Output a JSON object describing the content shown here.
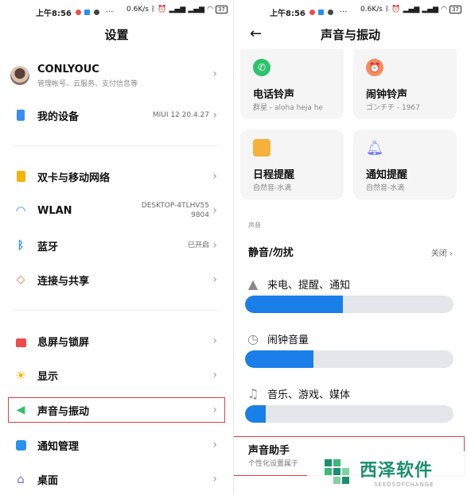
{
  "status_bar": {
    "time": "上午8:56",
    "speed": "0.6K/s",
    "battery": "37",
    "more": "···"
  },
  "left": {
    "title": "设置",
    "account": {
      "name": "CONLYOUC",
      "subtitle": "管理帐号、云服务、支付信息等"
    },
    "items": [
      {
        "label": "我的设备",
        "value": "MIUI 12 20.4.27",
        "icon": "phone-icon",
        "color": "#3a8df0"
      },
      {
        "label": "双卡与移动网络",
        "value": "",
        "icon": "sim-card-icon",
        "color": "#f5b400"
      },
      {
        "label": "WLAN",
        "value": "DESKTOP-4TLHV55\n9804",
        "icon": "wifi-icon",
        "color": "#2aa8f2"
      },
      {
        "label": "蓝牙",
        "value": "已开启",
        "icon": "bluetooth-icon",
        "color": "#2a8ff2"
      },
      {
        "label": "连接与共享",
        "value": "",
        "icon": "share-icon",
        "color": "#f06a3a"
      },
      {
        "label": "息屏与锁屏",
        "value": "",
        "icon": "lock-icon",
        "color": "#f04b4b"
      },
      {
        "label": "显示",
        "value": "",
        "icon": "sun-icon",
        "color": "#f5b400"
      },
      {
        "label": "声音与振动",
        "value": "",
        "icon": "speaker-icon",
        "color": "#2cc36b"
      },
      {
        "label": "通知管理",
        "value": "",
        "icon": "notification-icon",
        "color": "#2a8ff2"
      },
      {
        "label": "桌面",
        "value": "",
        "icon": "home-icon",
        "color": "#7a66e0"
      }
    ]
  },
  "right": {
    "title": "声音与振动",
    "cards": [
      {
        "title": "电话铃声",
        "subtitle": "群星 - aloha heja he",
        "icon": "phone-ring-icon",
        "color": "#2cc36b"
      },
      {
        "title": "闹钟铃声",
        "subtitle": "ゴンチチ - 1967",
        "icon": "alarm-clock-icon",
        "color": "#f78a5e"
      },
      {
        "title": "日程提醒",
        "subtitle": "自然音-水滴",
        "icon": "calendar-icon",
        "color": "#f5b13a"
      },
      {
        "title": "通知提醒",
        "subtitle": "自然音-水滴",
        "icon": "bell-icon",
        "color": "#6f7cf0"
      }
    ],
    "section_label": "声音",
    "mute": {
      "label": "静音/勿扰",
      "value": "关闭"
    },
    "volumes": [
      {
        "label": "来电、提醒、通知",
        "level": 0.47,
        "icon": "bell-outline-icon"
      },
      {
        "label": "闹钟音量",
        "level": 0.33,
        "icon": "alarm-outline-icon"
      },
      {
        "label": "音乐、游戏、媒体",
        "level": 0.1,
        "icon": "music-note-icon"
      }
    ],
    "assistant": {
      "title": "声音助手",
      "subtitle": "个性化设置属于"
    }
  },
  "watermark": {
    "cn": "西泽软件",
    "en": "SEEDSOFCHANGE"
  },
  "colors": {
    "accent": "#1a7fe8",
    "highlight": "#d94040"
  }
}
